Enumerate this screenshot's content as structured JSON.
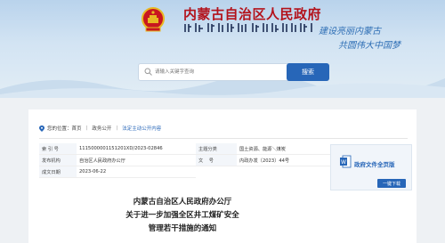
{
  "header": {
    "site_title": "内蒙古自治区人民政府",
    "slogan_line1": "建设亮丽内蒙古",
    "slogan_line2": "共圆伟大中国梦"
  },
  "search": {
    "placeholder": "请输入关键字查询",
    "button_label": "搜索"
  },
  "breadcrumb": {
    "prefix": "您的位置：",
    "items": [
      "首页",
      "政务公开",
      "法定主动公开内容"
    ]
  },
  "meta": {
    "index_label": "索 引 号",
    "index_value": "1115000001151201XD/2023-02846",
    "category_label": "主题分类",
    "category_value": "国土资源、能源＼煤炭",
    "issuer_label": "发布机构",
    "issuer_value": "自治区人民政府办公厅",
    "docno_label": "文    号",
    "docno_value": "内政办发〔2023〕44号",
    "date_label": "成文日期",
    "date_value": "2023-06-22"
  },
  "fulltext": {
    "title": "政府文件全页版",
    "download_label": "一键下载"
  },
  "document": {
    "title_line1": "内蒙古自治区人民政府办公厅",
    "title_line2": "关于进一步加强全区井工煤矿安全",
    "title_line3": "管理若干措施的通知"
  },
  "colors": {
    "accent": "#2766b8",
    "title_red": "#b3121b",
    "banner_top": "#b9d3ec"
  }
}
